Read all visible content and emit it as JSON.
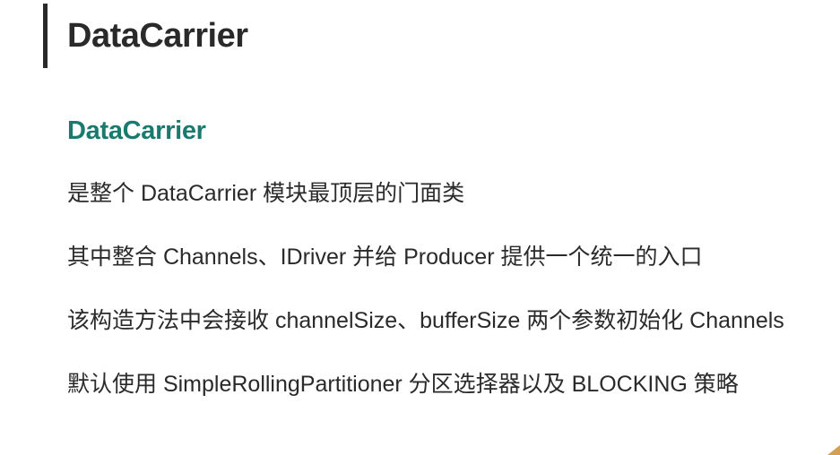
{
  "header": {
    "title": "DataCarrier"
  },
  "content": {
    "subtitle": "DataCarrier",
    "paragraphs": [
      "是整个 DataCarrier 模块最顶层的门面类",
      "其中整合 Channels、IDriver 并给 Producer 提供一个统一的入口",
      "该构造方法中会接收 channelSize、bufferSize 两个参数初始化 Channels",
      "默认使用 SimpleRollingPartitioner 分区选择器以及 BLOCKING 策略"
    ]
  }
}
